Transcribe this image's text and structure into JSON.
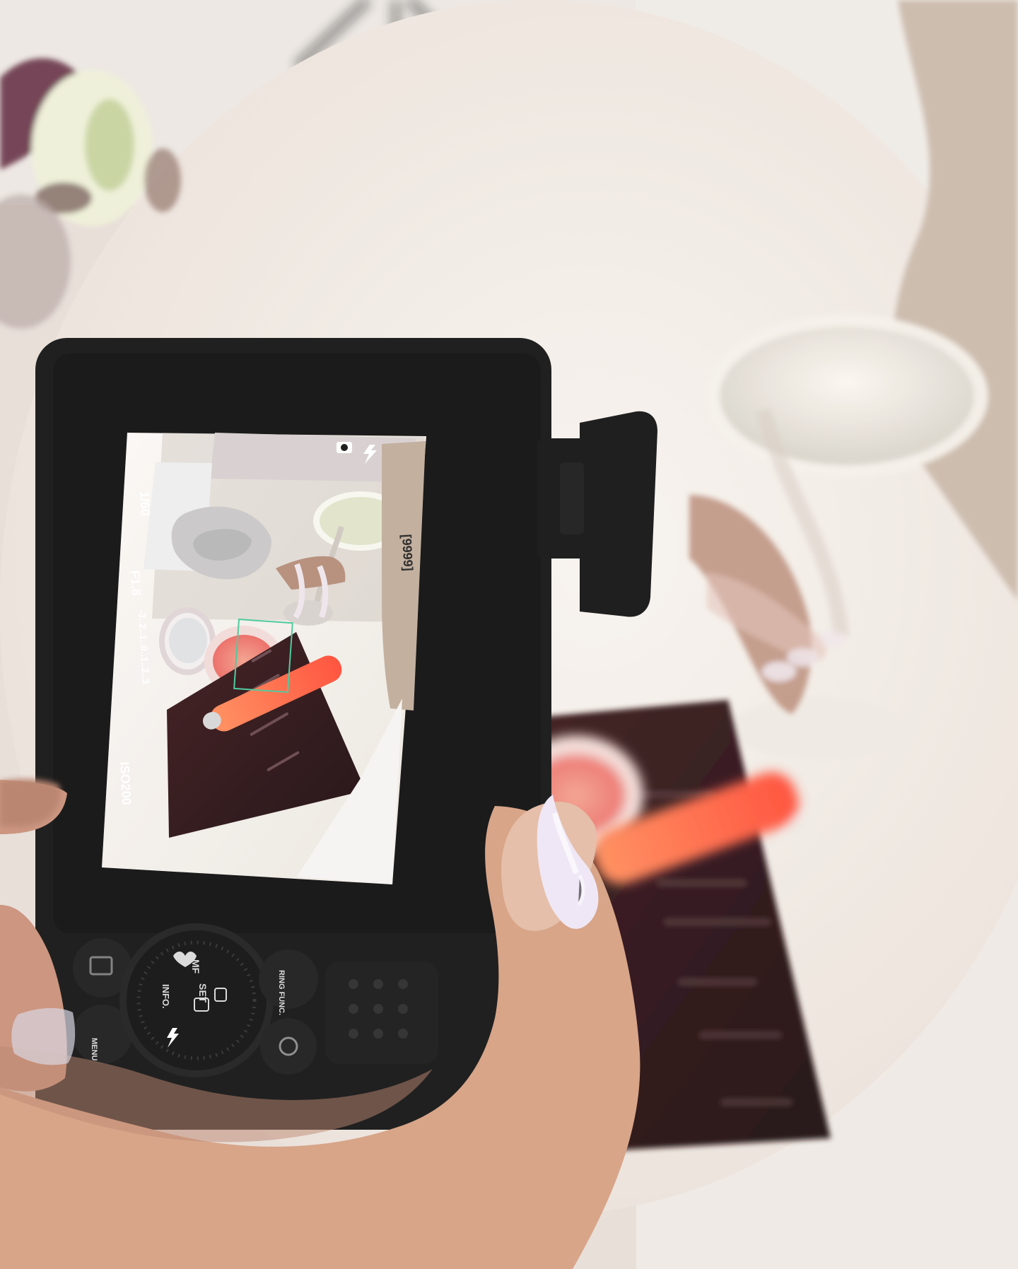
{
  "scene": {
    "camera_hud": {
      "shutter_speed": "1/60",
      "aperture": "F1.8",
      "exposure_scale": "-3..2..1..0..1..2..3",
      "iso": "ISO200",
      "shots_remaining": "[9999]"
    },
    "camera_buttons": {
      "mf": "MF",
      "set": "SET",
      "info": "INFO.",
      "menu": "MENU",
      "ring_func": "RING FUNC."
    },
    "icons": [
      "camera-mode-icon",
      "flash-icon",
      "playback-icon",
      "dial-icon",
      "tulip-icon"
    ],
    "colors": {
      "background": "#ebe4de",
      "table": "#f2ece6",
      "camera_body": "#141414",
      "screen_bezel": "#0d0d0d",
      "lipstick": "#ff5b3f",
      "blush": "#f06f68",
      "menu_card": "#2b1114",
      "focus_box": "#46c89a",
      "skin": "#d8a488",
      "flower": "#eff1d7"
    }
  }
}
